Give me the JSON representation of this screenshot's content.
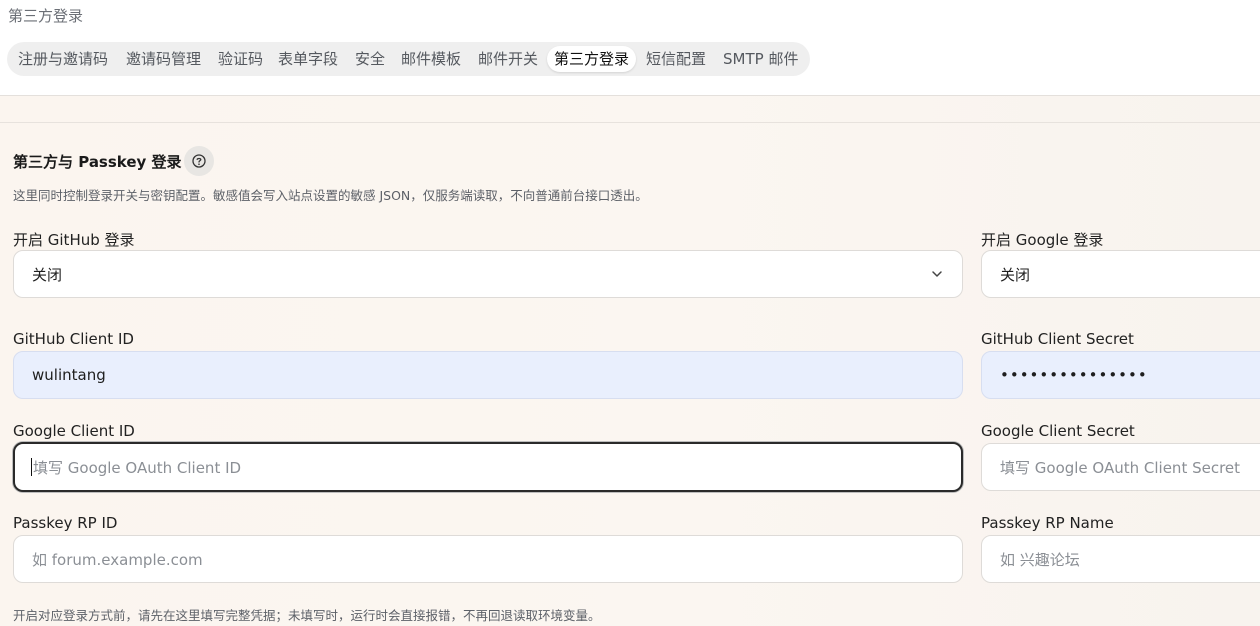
{
  "header": {
    "page_label": "第三方登录"
  },
  "tabs": [
    {
      "label": "注册与邀请码"
    },
    {
      "label": "邀请码管理"
    },
    {
      "label": "验证码"
    },
    {
      "label": "表单字段"
    },
    {
      "label": "安全"
    },
    {
      "label": "邮件模板"
    },
    {
      "label": "邮件开关"
    },
    {
      "label": "第三方登录",
      "active": true
    },
    {
      "label": "短信配置"
    },
    {
      "label": "SMTP 邮件"
    }
  ],
  "section": {
    "title": "第三方与 Passkey 登录",
    "help_icon": "question-circle-icon",
    "description": "这里同时控制登录开关与密钥配置。敏感值会写入站点设置的敏感 JSON，仅服务端读取，不向普通前台接口透出。"
  },
  "fields": {
    "github_login": {
      "label": "开启 GitHub 登录",
      "value": "关闭"
    },
    "google_login": {
      "label": "开启 Google 登录",
      "value": "关闭"
    },
    "github_client_id": {
      "label": "GitHub Client ID",
      "value": "wulintang"
    },
    "github_client_secret": {
      "label": "GitHub Client Secret",
      "value": "•••••••••••••••"
    },
    "google_client_id": {
      "label": "Google Client ID",
      "placeholder": "填写 Google OAuth Client ID"
    },
    "google_client_secret": {
      "label": "Google Client Secret",
      "placeholder": "填写 Google OAuth Client Secret"
    },
    "passkey_rp_id": {
      "label": "Passkey RP ID",
      "placeholder": "如 forum.example.com"
    },
    "passkey_rp_name": {
      "label": "Passkey RP Name",
      "placeholder": "如 兴趣论坛"
    }
  },
  "footer_note": "开启对应登录方式前，请先在这里填写完整凭据；未填写时，运行时会直接报错，不再回退读取环境变量。"
}
